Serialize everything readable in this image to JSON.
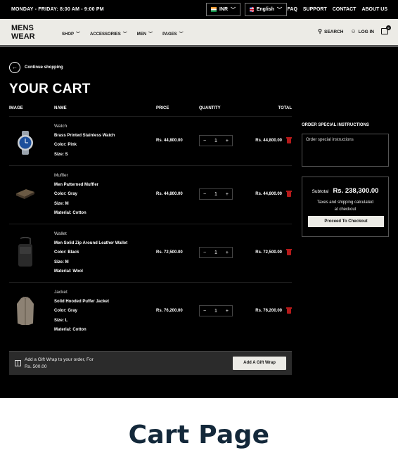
{
  "topbar": {
    "hours": "MONDAY - FRIDAY: 8:00 AM - 9:00 PM",
    "currency": "INR",
    "language": "English",
    "links": [
      "FAQ",
      "SUPPORT",
      "CONTACT",
      "ABOUT US"
    ]
  },
  "header": {
    "logo_line1": "MENS",
    "logo_line2": "WEAR",
    "nav": [
      "SHOP",
      "ACCESSORIES",
      "MEN",
      "PAGES"
    ],
    "search_label": "SEARCH",
    "login_label": "LOG IN",
    "cart_count": "0"
  },
  "cart": {
    "back_label": "Continue shopping",
    "title": "YOUR CART",
    "columns": {
      "image": "IMAGE",
      "name": "NAME",
      "price": "PRICE",
      "quantity": "QUANTITY",
      "total": "TOTAL"
    },
    "items": [
      {
        "category": "Watch",
        "name": "Brass Printed Stainless Watch",
        "attrs": [
          "Color: Pink",
          "Size: S"
        ],
        "price": "Rs. 44,800.00",
        "qty": "1",
        "total": "Rs. 44,800.00"
      },
      {
        "category": "Muffler",
        "name": "Men Patterned Muffler",
        "attrs": [
          "Color: Gray",
          "Size: M",
          "Material: Cotton"
        ],
        "price": "Rs. 44,800.00",
        "qty": "1",
        "total": "Rs. 44,800.00"
      },
      {
        "category": "Wallet",
        "name": "Men Solid Zip Around Leather Wallet",
        "attrs": [
          "Color: Black",
          "Size: M",
          "Material: Wool"
        ],
        "price": "Rs. 72,500.00",
        "qty": "1",
        "total": "Rs. 72,500.00"
      },
      {
        "category": "Jacket",
        "name": "Solid Hooded Puffer Jacket",
        "attrs": [
          "Color: Gray",
          "Size: L",
          "Material: Cotton"
        ],
        "price": "Rs. 76,200.00",
        "qty": "1",
        "total": "Rs. 76,200.00"
      }
    ],
    "gift_text_line1": "Add a Gift Wrap to your order, For",
    "gift_text_line2": "Rs. 500.00",
    "gift_button": "Add A Gift Wrap"
  },
  "sidebar": {
    "instructions_heading": "ORDER SPECIAL INSTRUCTIONS",
    "instructions_placeholder": "Order special instructions",
    "subtotal_label": "Subtotal",
    "subtotal_value": "Rs. 238,300.00",
    "taxes_line1": "Taxes and shipping calculated",
    "taxes_line2": "at checkout",
    "checkout_button": "Proceed To Checkout"
  },
  "caption": "Cart Page"
}
